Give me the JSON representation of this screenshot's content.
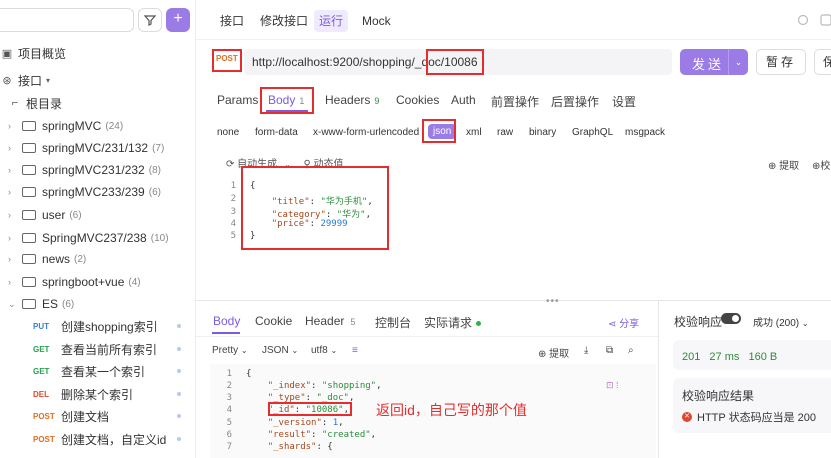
{
  "sidebar": {
    "overview": "项目概览",
    "api_root": "接口",
    "root_dir": "根目录",
    "folders": [
      {
        "name": "springMVC",
        "count": "(24)"
      },
      {
        "name": "springMVC/231/132",
        "count": "(7)"
      },
      {
        "name": "springMVC231/232",
        "count": "(8)"
      },
      {
        "name": "springMVC233/239",
        "count": "(6)"
      },
      {
        "name": "user",
        "count": "(6)"
      },
      {
        "name": "SpringMVC237/238",
        "count": "(10)"
      },
      {
        "name": "news",
        "count": "(2)"
      },
      {
        "name": "springboot+vue",
        "count": "(4)"
      },
      {
        "name": "ES",
        "count": "(6)"
      }
    ],
    "apis": [
      {
        "method": "PUT",
        "name": "创建shopping索引"
      },
      {
        "method": "GET",
        "name": "查看当前所有索引"
      },
      {
        "method": "GET",
        "name": "查看某一个索引"
      },
      {
        "method": "DEL",
        "name": "删除某个索引"
      },
      {
        "method": "POST",
        "name": "创建文档"
      },
      {
        "method": "POST",
        "name": "创建文档，自定义id"
      }
    ]
  },
  "top_tabs": [
    "接口",
    "修改接口",
    "运行",
    "Mock"
  ],
  "request": {
    "method": "POST",
    "url_prefix": "http://localhost:9200/shopping/_doc/",
    "url_id": "10086",
    "send_label": "发送",
    "save_label": "暂存",
    "save2_label": "保"
  },
  "param_tabs": [
    {
      "label": "Params",
      "badge": ""
    },
    {
      "label": "Body",
      "badge": "1"
    },
    {
      "label": "Headers",
      "badge": "9"
    },
    {
      "label": "Cookies",
      "badge": ""
    },
    {
      "label": "Auth",
      "badge": ""
    },
    {
      "label": "前置操作",
      "badge": ""
    },
    {
      "label": "后置操作",
      "badge": ""
    },
    {
      "label": "设置",
      "badge": ""
    }
  ],
  "body_types": [
    "none",
    "form-data",
    "x-www-form-urlencoded",
    "json",
    "xml",
    "raw",
    "binary",
    "GraphQL",
    "msgpack"
  ],
  "editor_tools": {
    "auto_gen": "自动生成",
    "dynamic": "动态值",
    "extract": "提取",
    "more": "校"
  },
  "request_body": [
    "{",
    "    \"title\": \"华为手机\",",
    "    \"category\": \"华为\",",
    "    \"price\": 29999",
    "}"
  ],
  "response_tabs": [
    {
      "label": "Body",
      "badge": ""
    },
    {
      "label": "Cookie",
      "badge": ""
    },
    {
      "label": "Header",
      "badge": "5"
    },
    {
      "label": "控制台",
      "badge": ""
    },
    {
      "label": "实际请求",
      "badge": ""
    }
  ],
  "share_label": "分享",
  "format": {
    "pretty": "Pretty",
    "type": "JSON",
    "encoding": "utf8",
    "extract": "提取"
  },
  "response_body": [
    "{",
    "    \"_index\": \"shopping\",",
    "    \"_type\": \"_doc\",",
    "    \"_id\": \"10086\",",
    "    \"_version\": 1,",
    "    \"result\": \"created\",",
    "    \"_shards\": {"
  ],
  "annotation": "返回id，自己写的那个值",
  "right_panel": {
    "title": "校验响应",
    "success": "成功 (200)",
    "status": "201",
    "time": "27 ms",
    "size": "160 B",
    "result_title": "校验响应结果",
    "result_line": "HTTP 状态码应当是 200"
  }
}
